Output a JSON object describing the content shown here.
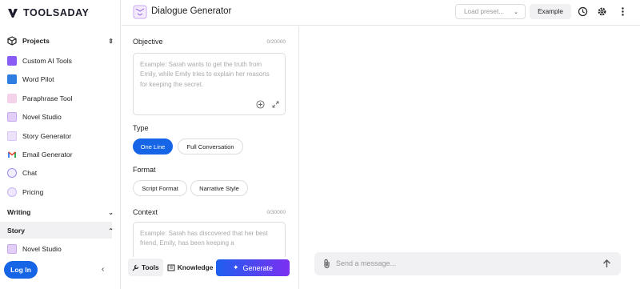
{
  "brand": {
    "name": "TOOLSADAY"
  },
  "sidebar": {
    "projects_label": "Projects",
    "items": [
      {
        "label": "Custom AI Tools",
        "icon": "layers-icon",
        "color": "#8a5cf6"
      },
      {
        "label": "Word Pilot",
        "icon": "book-icon",
        "color": "#2f7de1"
      },
      {
        "label": "Paraphrase Tool",
        "icon": "feather-icon",
        "color": "#e9a3d6"
      },
      {
        "label": "Novel Studio",
        "icon": "novel-icon",
        "color": "#c9a7f0"
      },
      {
        "label": "Story Generator",
        "icon": "story-icon",
        "color": "#d8c4f7"
      },
      {
        "label": "Email Generator",
        "icon": "gmail-icon",
        "color": "#ea4335"
      },
      {
        "label": "Chat",
        "icon": "chat-bubble-icon",
        "color": "#9b8cf0"
      },
      {
        "label": "Pricing",
        "icon": "pricing-icon",
        "color": "#c9b6f5"
      }
    ],
    "writing_label": "Writing",
    "story_label": "Story",
    "story_items": [
      {
        "label": "Novel Studio",
        "icon": "novel-icon",
        "color": "#c9a7f0"
      }
    ],
    "login_label": "Log In"
  },
  "header": {
    "title": "Dialogue Generator",
    "load_preset": "Load preset...",
    "example_label": "Example"
  },
  "form": {
    "objective_label": "Objective",
    "objective_count": "0/20000",
    "objective_placeholder": "Example: Sarah wants to get the truth from Emily, while Emily tries to explain her reasons for keeping the secret.",
    "type_label": "Type",
    "type_options": [
      "One Line",
      "Full Conversation"
    ],
    "type_selected": "One Line",
    "format_label": "Format",
    "format_options": [
      "Script Format",
      "Narrative Style"
    ],
    "context_label": "Context",
    "context_count": "0/30000",
    "context_placeholder": "Example: Sarah has discovered that her best friend, Emily, has been keeping a",
    "tools_label": "Tools",
    "knowledge_label": "Knowledge",
    "generate_label": "Generate"
  },
  "chat": {
    "placeholder": "Send a message..."
  },
  "colors": {
    "accent": "#1565e6",
    "gradient_end": "#7b2ff0"
  }
}
